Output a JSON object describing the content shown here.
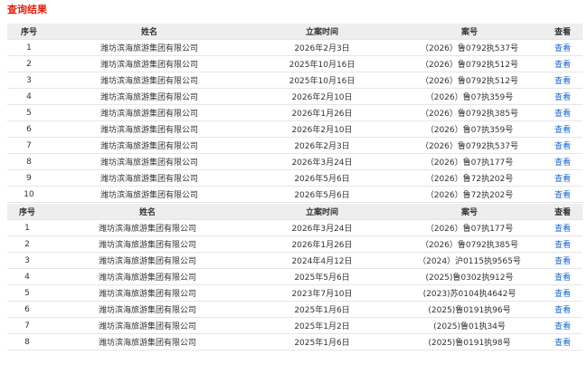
{
  "page_title": "查询结果",
  "table1": {
    "headers": {
      "seq": "序号",
      "name": "姓名",
      "date": "立案时间",
      "case": "案号",
      "view": "查看"
    },
    "rows": [
      {
        "seq": "1",
        "name": "潍坊滨海旅游集团有限公司",
        "date": "2026年2月3日",
        "case": "（2026）鲁0792执537号",
        "view": "查看"
      },
      {
        "seq": "2",
        "name": "潍坊滨海旅游集团有限公司",
        "date": "2025年10月16日",
        "case": "（2026）鲁0792执512号",
        "view": "查看"
      },
      {
        "seq": "3",
        "name": "潍坊滨海旅游集团有限公司",
        "date": "2025年10月16日",
        "case": "（2026）鲁0792执512号",
        "view": "查看"
      },
      {
        "seq": "4",
        "name": "潍坊滨海旅游集团有限公司",
        "date": "2026年2月10日",
        "case": "（2026）鲁07执359号",
        "view": "查看"
      },
      {
        "seq": "5",
        "name": "潍坊滨海旅游集团有限公司",
        "date": "2026年1月26日",
        "case": "（2026）鲁0792执385号",
        "view": "查看"
      },
      {
        "seq": "6",
        "name": "潍坊滨海旅游集团有限公司",
        "date": "2026年2月10日",
        "case": "（2026）鲁07执359号",
        "view": "查看"
      },
      {
        "seq": "7",
        "name": "潍坊滨海旅游集团有限公司",
        "date": "2026年2月3日",
        "case": "（2026）鲁0792执537号",
        "view": "查看"
      },
      {
        "seq": "8",
        "name": "潍坊滨海旅游集团有限公司",
        "date": "2026年3月24日",
        "case": "（2026）鲁07执177号",
        "view": "查看"
      },
      {
        "seq": "9",
        "name": "潍坊滨海旅游集团有限公司",
        "date": "2026年5月6日",
        "case": "（2026）鲁72执202号",
        "view": "查看"
      },
      {
        "seq": "10",
        "name": "潍坊滨海旅游集团有限公司",
        "date": "2026年5月6日",
        "case": "（2026）鲁72执202号",
        "view": "查看"
      }
    ]
  },
  "table2": {
    "headers": {
      "seq": "序号",
      "name": "姓名",
      "date": "立案时间",
      "case": "案号",
      "view": "查看"
    },
    "rows": [
      {
        "seq": "1",
        "name": "潍坊滨海旅游集团有限公司",
        "date": "2026年3月24日",
        "case": "（2026）鲁07执177号",
        "view": "查看"
      },
      {
        "seq": "2",
        "name": "潍坊滨海旅游集团有限公司",
        "date": "2026年1月26日",
        "case": "（2026）鲁0792执385号",
        "view": "查看"
      },
      {
        "seq": "3",
        "name": "潍坊滨海旅游集团有限公司",
        "date": "2024年4月12日",
        "case": "（2024）沪0115执9565号",
        "view": "查看"
      },
      {
        "seq": "4",
        "name": "潍坊滨海旅游集团有限公司",
        "date": "2025年5月6日",
        "case": "(2025)鲁0302执912号",
        "view": "查看"
      },
      {
        "seq": "5",
        "name": "潍坊滨海旅游集团有限公司",
        "date": "2023年7月10日",
        "case": "(2023)苏0104执4642号",
        "view": "查看"
      },
      {
        "seq": "6",
        "name": "潍坊滨海旅游集团有限公司",
        "date": "2025年1月6日",
        "case": "(2025)鲁0191执96号",
        "view": "查看"
      },
      {
        "seq": "7",
        "name": "潍坊滨海旅游集团有限公司",
        "date": "2025年1月2日",
        "case": "(2025)鲁01执34号",
        "view": "查看"
      },
      {
        "seq": "8",
        "name": "潍坊滨海旅游集团有限公司",
        "date": "2025年1月6日",
        "case": "(2025)鲁0191执98号",
        "view": "查看"
      }
    ]
  }
}
